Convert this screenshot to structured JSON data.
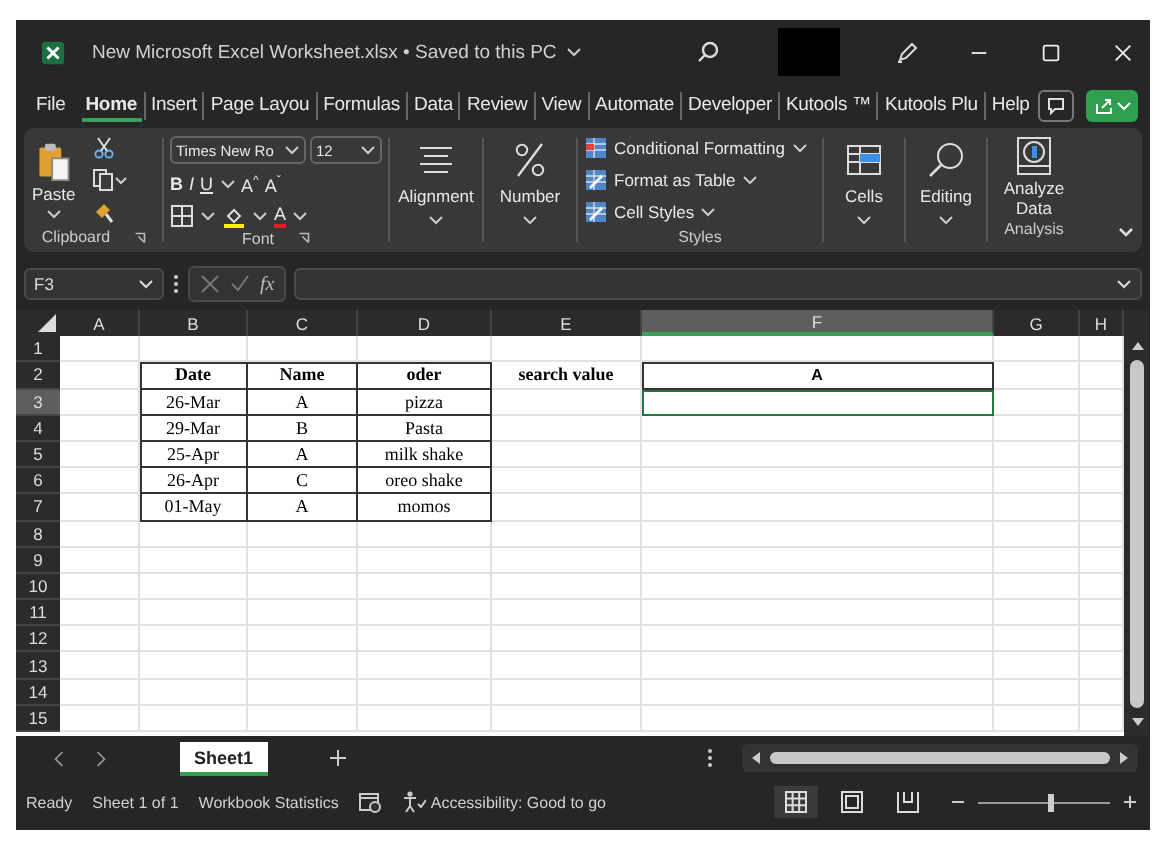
{
  "window": {
    "title": "New Microsoft Excel Worksheet.xlsx • Saved to this PC"
  },
  "ribbon_tabs": [
    {
      "label": "File",
      "selected": false
    },
    {
      "label": "Home",
      "selected": true
    },
    {
      "label": "Insert",
      "selected": false
    },
    {
      "label": "Page Layou",
      "selected": false
    },
    {
      "label": "Formulas",
      "selected": false
    },
    {
      "label": "Data",
      "selected": false
    },
    {
      "label": "Review",
      "selected": false
    },
    {
      "label": "View",
      "selected": false
    },
    {
      "label": "Automate",
      "selected": false
    },
    {
      "label": "Developer",
      "selected": false
    },
    {
      "label": "Kutools ™",
      "selected": false
    },
    {
      "label": "Kutools Plu",
      "selected": false
    },
    {
      "label": "Help",
      "selected": false
    }
  ],
  "ribbon": {
    "clipboard": {
      "paste": "Paste",
      "label": "Clipboard"
    },
    "font": {
      "name": "Times New Ro",
      "size": "12",
      "bold": "B",
      "italic": "I",
      "underline": "U",
      "grow": "A",
      "grow_mark": "^",
      "shrink": "A",
      "shrink_mark": "ˇ",
      "font_color_letter": "A",
      "label": "Font"
    },
    "alignment": "Alignment",
    "number": "Number",
    "styles": {
      "items": [
        "Conditional Formatting",
        "Format as Table",
        "Cell Styles"
      ],
      "label": "Styles"
    },
    "cells": "Cells",
    "editing": "Editing",
    "analyze": {
      "button": "Analyze Data",
      "label": "Analysis"
    }
  },
  "formula_bar": {
    "name_box": "F3",
    "function_label": "fx"
  },
  "sheet": {
    "columns": [
      {
        "label": "A",
        "selected": false
      },
      {
        "label": "B",
        "selected": false
      },
      {
        "label": "C",
        "selected": false
      },
      {
        "label": "D",
        "selected": false
      },
      {
        "label": "E",
        "selected": false
      },
      {
        "label": "F",
        "selected": true
      },
      {
        "label": "G",
        "selected": false
      },
      {
        "label": "H",
        "selected": false
      }
    ],
    "rows": [
      {
        "label": "1",
        "selected": false
      },
      {
        "label": "2",
        "selected": false
      },
      {
        "label": "3",
        "selected": true
      },
      {
        "label": "4",
        "selected": false
      },
      {
        "label": "5",
        "selected": false
      },
      {
        "label": "6",
        "selected": false
      },
      {
        "label": "7",
        "selected": false
      },
      {
        "label": "8",
        "selected": false
      },
      {
        "label": "9",
        "selected": false
      },
      {
        "label": "10",
        "selected": false
      },
      {
        "label": "11",
        "selected": false
      },
      {
        "label": "12",
        "selected": false
      },
      {
        "label": "13",
        "selected": false
      },
      {
        "label": "14",
        "selected": false
      },
      {
        "label": "15",
        "selected": false
      }
    ],
    "table": {
      "columns": [
        "Date",
        "Name",
        "oder"
      ],
      "rows": [
        [
          "26-Mar",
          "A",
          "pizza"
        ],
        [
          "29-Mar",
          "B",
          "Pasta"
        ],
        [
          "25-Apr",
          "A",
          "milk shake"
        ],
        [
          "26-Apr",
          "C",
          "oreo shake"
        ],
        [
          "01-May",
          "A",
          "momos"
        ]
      ]
    },
    "lookup": {
      "label": "search value",
      "header": "A"
    }
  },
  "sheet_tabs": [
    {
      "label": "Sheet1",
      "selected": true
    }
  ],
  "status_bar": {
    "mode": "Ready",
    "sheet_count": "Sheet 1 of 1",
    "statistics": "Workbook Statistics",
    "accessibility": "Accessibility: Good to go",
    "views": [
      {
        "kind": "normal",
        "selected": true
      },
      {
        "kind": "page_layout",
        "selected": false
      },
      {
        "kind": "page_break",
        "selected": false
      }
    ],
    "zoom": {
      "level": 0.55
    }
  }
}
